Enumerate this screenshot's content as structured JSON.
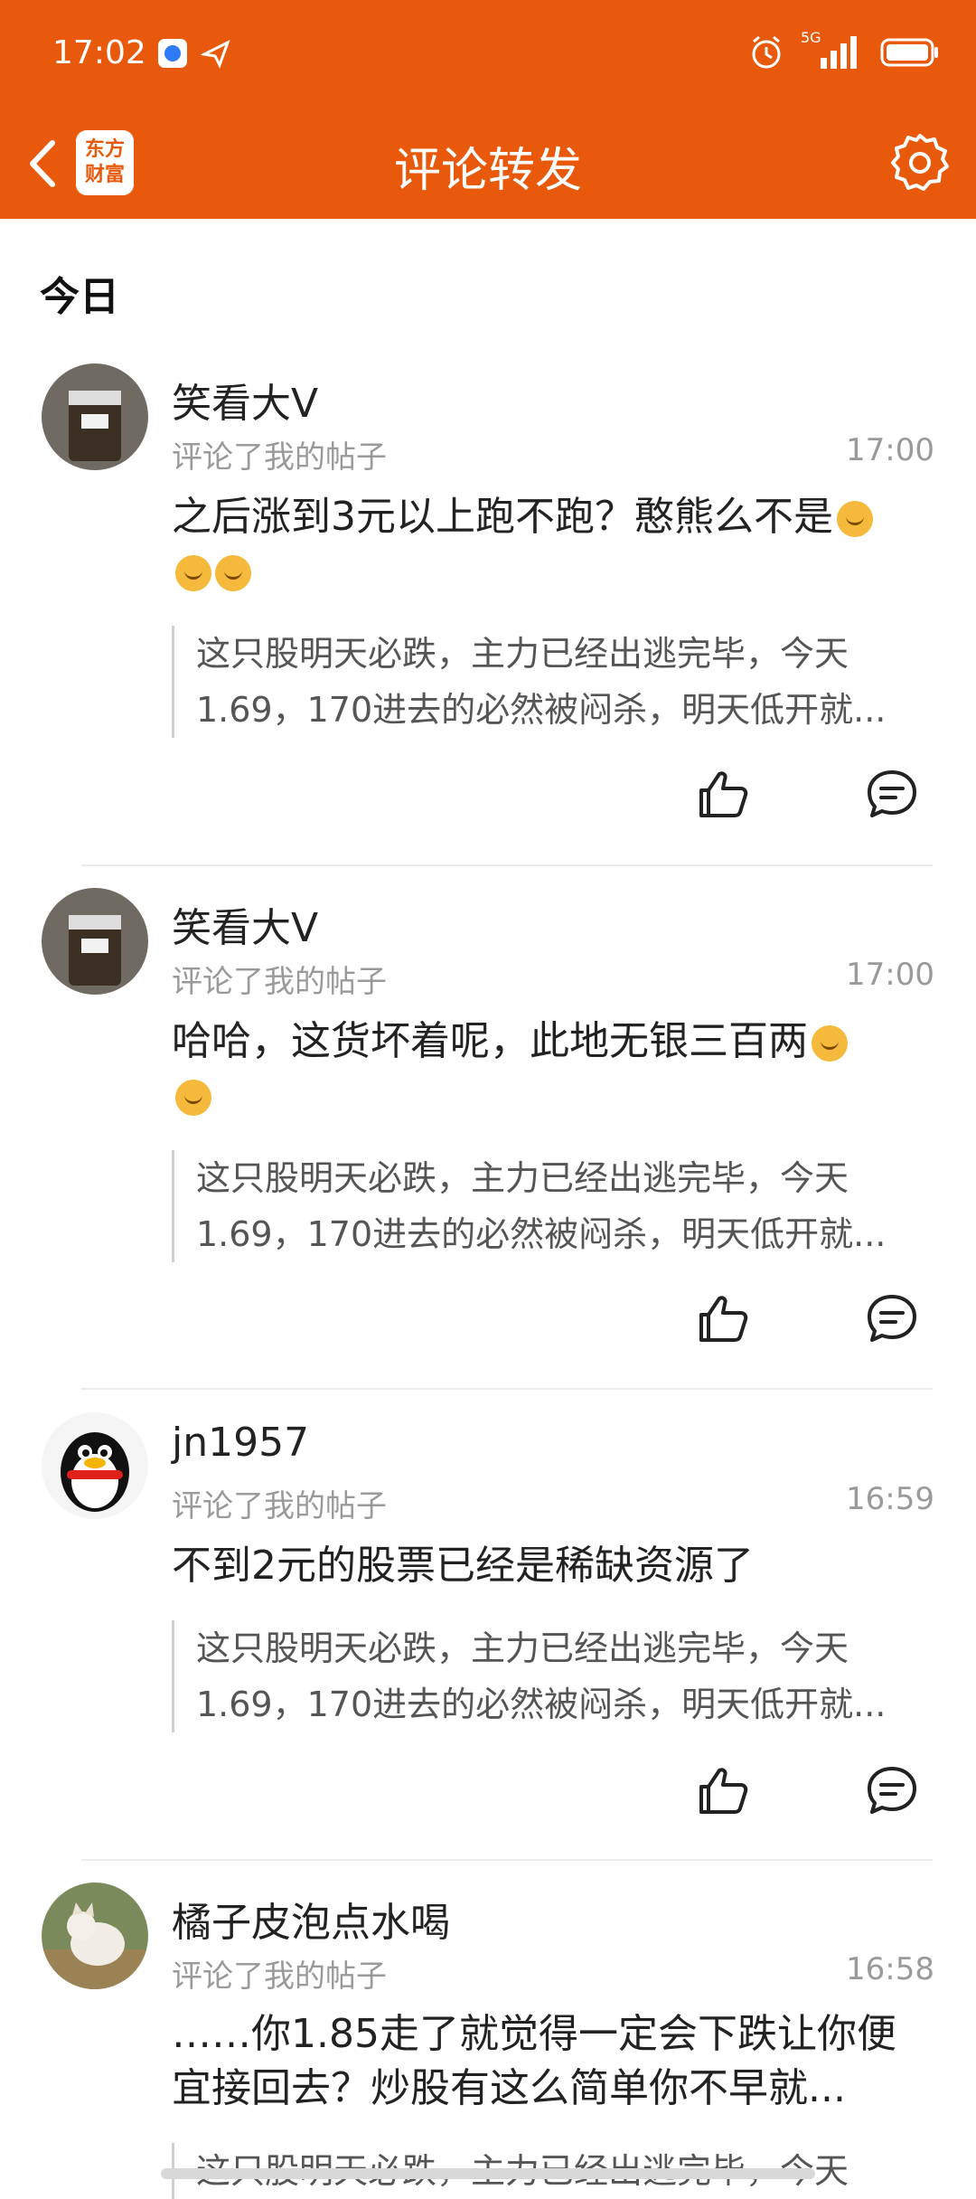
{
  "status_bar": {
    "time": "17:02",
    "network": "5G"
  },
  "header": {
    "title": "评论转发",
    "logo_line1": "东方",
    "logo_line2": "财富"
  },
  "section": {
    "title": "今日"
  },
  "comments": [
    {
      "username": "笑看大V",
      "action": "评论了我的帖子",
      "time": "17:00",
      "content": "之后涨到3元以上跑不跑？憨熊么不是",
      "quote_line1": "这只股明天必跌，主力已经出逃完毕，今天",
      "quote_line2": "1.69，170进去的必然被闷杀，明天低开就..."
    },
    {
      "username": "笑看大V",
      "action": "评论了我的帖子",
      "time": "17:00",
      "content": "哈哈，这货坏着呢，此地无银三百两",
      "quote_line1": "这只股明天必跌，主力已经出逃完毕，今天",
      "quote_line2": "1.69，170进去的必然被闷杀，明天低开就..."
    },
    {
      "username": "jn1957",
      "action": "评论了我的帖子",
      "time": "16:59",
      "content": "不到2元的股票已经是稀缺资源了",
      "quote_line1": "这只股明天必跌，主力已经出逃完毕，今天",
      "quote_line2": "1.69，170进去的必然被闷杀，明天低开就..."
    },
    {
      "username": "橘子皮泡点水喝",
      "action": "评论了我的帖子",
      "time": "16:58",
      "content_line1": "……你1.85走了就觉得一定会下跌让你便",
      "content_line2": "宜接回去？炒股有这么简单你不早就...",
      "quote_line1": "这只股明天必跌，主力已经出逃完毕，今天"
    }
  ],
  "colors": {
    "brand": "#E8590C",
    "muted": "#9a9a9a"
  }
}
